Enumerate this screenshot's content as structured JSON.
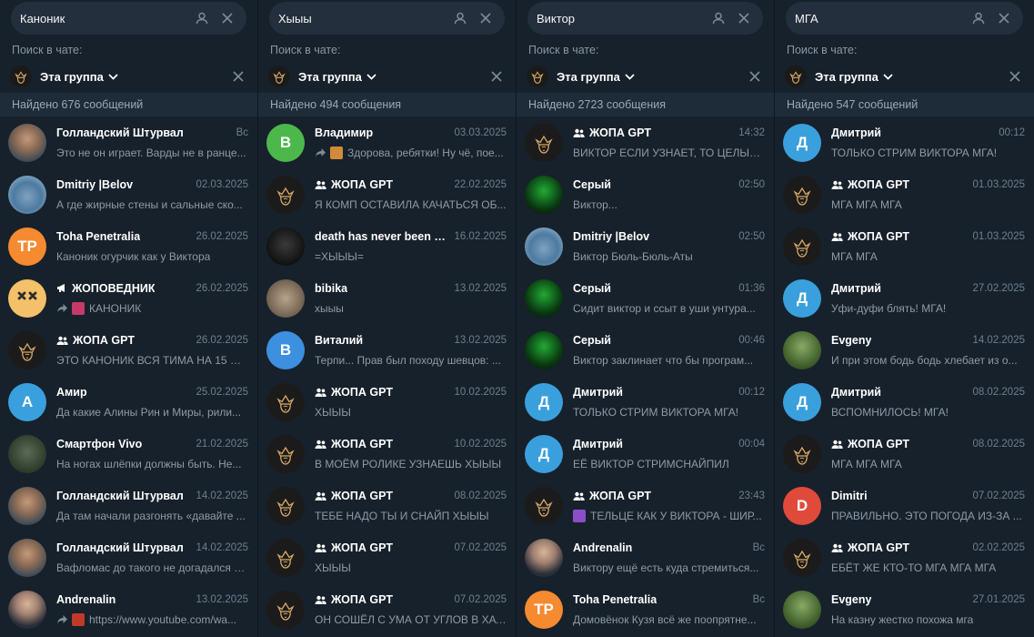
{
  "labels": {
    "search_in_chat": "Поиск в чате:"
  },
  "panels": [
    {
      "query": "Каноник",
      "group": "Эта группа",
      "found": "Найдено 676 сообщений",
      "rows": [
        {
          "name": "Голландский Штурвал",
          "date": "Вс",
          "msg": "Это не он играет. Варды не в ранце...",
          "av": "photo",
          "icon": ""
        },
        {
          "name": "Dmitriy |Belov",
          "date": "02.03.2025",
          "msg": "А где жирные стены и сальные ско...",
          "av": "photo2",
          "icon": ""
        },
        {
          "name": "Toha Penetralia",
          "date": "26.02.2025",
          "msg": "Каноник огурчик как у Виктора",
          "av": "letter",
          "letter": "TP",
          "color": "#f58a31",
          "icon": ""
        },
        {
          "name": "ЖОПОВЕДНИК",
          "date": "26.02.2025",
          "msg": "КАНОНИК",
          "av": "face",
          "icon": "megaphone",
          "fwd": true,
          "thumb": "#c63a6a"
        },
        {
          "name": "ЖОПА GPT",
          "date": "26.02.2025",
          "msg": "ЭТО КАНОНИК ВСЯ ТИМА НА 15 СО...",
          "av": "crown",
          "icon": "group"
        },
        {
          "name": "Амир",
          "date": "25.02.2025",
          "msg": "Да какие Алины Рин и Миры, рили...",
          "av": "letter",
          "letter": "А",
          "color": "#3aa0dd",
          "icon": ""
        },
        {
          "name": "Смартфон Vivo",
          "date": "21.02.2025",
          "msg": "На ногах шлёпки должны быть. Не...",
          "av": "soldier",
          "icon": ""
        },
        {
          "name": "Голландский Штурвал",
          "date": "14.02.2025",
          "msg": "Да там начали разгонять «давайте ...",
          "av": "photo",
          "icon": ""
        },
        {
          "name": "Голландский Штурвал",
          "date": "14.02.2025",
          "msg": "Вафломас до такого не догадался п...",
          "av": "photo",
          "icon": ""
        },
        {
          "name": "Andrenalin",
          "date": "13.02.2025",
          "msg": "https://www.youtube.com/wa...",
          "av": "suit",
          "icon": "",
          "fwd": true,
          "thumb": "#c0392b"
        }
      ]
    },
    {
      "query": "Хыыы",
      "group": "Эта группа",
      "found": "Найдено 494 сообщения",
      "rows": [
        {
          "name": "Владимир",
          "date": "03.03.2025",
          "msg": "Здорова, ребятки! Ну чё, пое...",
          "av": "letter",
          "letter": "В",
          "color": "#4cb84c",
          "icon": "",
          "fwd": true,
          "thumb": "#d08a3a"
        },
        {
          "name": "ЖОПА GPT",
          "date": "22.02.2025",
          "msg": "Я КОМП ОСТАВИЛА КАЧАТЬСЯ ОБ...",
          "av": "crown",
          "icon": "group"
        },
        {
          "name": "death has never been m...",
          "date": "16.02.2025",
          "msg": "=ХЫЫЫ=",
          "av": "dark",
          "icon": ""
        },
        {
          "name": "bibika",
          "date": "13.02.2025",
          "msg": "хыыы",
          "av": "cat",
          "icon": ""
        },
        {
          "name": "Виталий",
          "date": "13.02.2025",
          "msg": "Терпи... Прав был походу шевцов: ...",
          "av": "letter",
          "letter": "В",
          "color": "#3d8fe0",
          "icon": ""
        },
        {
          "name": "ЖОПА GPT",
          "date": "10.02.2025",
          "msg": "ХЫЫЫ",
          "av": "crown",
          "icon": "group"
        },
        {
          "name": "ЖОПА GPT",
          "date": "10.02.2025",
          "msg": "В МОЁМ РОЛИКЕ УЗНАЕШЬ ХЫЫЫ",
          "av": "crown",
          "icon": "group"
        },
        {
          "name": "ЖОПА GPT",
          "date": "08.02.2025",
          "msg": "ТЕБЕ НАДО ТЫ И СНАЙП ХЫЫЫ",
          "av": "crown",
          "icon": "group"
        },
        {
          "name": "ЖОПА GPT",
          "date": "07.02.2025",
          "msg": "ХЫЫЫ",
          "av": "crown",
          "icon": "group"
        },
        {
          "name": "ЖОПА GPT",
          "date": "07.02.2025",
          "msg": "ОН СОШЁЛ С УМА ОТ УГЛОВ В ХАТ...",
          "av": "crown",
          "icon": "group"
        }
      ]
    },
    {
      "query": "Виктор",
      "group": "Эта группа",
      "found": "Найдено 2723 сообщения",
      "rows": [
        {
          "name": "ЖОПА GPT",
          "date": "14:32",
          "msg": "ВИКТОР ЕСЛИ УЗНАЕТ, ТО ЦЕЛЫЙ ...",
          "av": "crown",
          "icon": "group"
        },
        {
          "name": "Серый",
          "date": "02:50",
          "msg": "Виктор...",
          "av": "green",
          "icon": ""
        },
        {
          "name": "Dmitriy |Belov",
          "date": "02:50",
          "msg": "Виктор Бюль-Бюль-Аты",
          "av": "photo2",
          "icon": ""
        },
        {
          "name": "Серый",
          "date": "01:36",
          "msg": "Сидит виктор и ссыт в уши унтура...",
          "av": "green",
          "icon": ""
        },
        {
          "name": "Серый",
          "date": "00:46",
          "msg": "Виктор заклинает что бы програм...",
          "av": "green",
          "icon": ""
        },
        {
          "name": "Дмитрий",
          "date": "00:12",
          "msg": "ТОЛЬКО СТРИМ ВИКТОРА МГА!",
          "av": "letter",
          "letter": "Д",
          "color": "#3aa0dd",
          "icon": ""
        },
        {
          "name": "Дмитрий",
          "date": "00:04",
          "msg": "ЕЁ ВИКТОР СТРИМСНАЙПИЛ",
          "av": "letter",
          "letter": "Д",
          "color": "#3aa0dd",
          "icon": ""
        },
        {
          "name": "ЖОПА GPT",
          "date": "23:43",
          "msg": "ТЕЛЬЦЕ КАК У ВИКТОРА - ШИР...",
          "av": "crown",
          "icon": "group",
          "thumb": "#8a4fc8"
        },
        {
          "name": "Andrenalin",
          "date": "Вс",
          "msg": "Виктору ещё есть куда стремиться...",
          "av": "suit",
          "icon": ""
        },
        {
          "name": "Toha Penetralia",
          "date": "Вс",
          "msg": "Домовёнок Кузя всё же поопрятне...",
          "av": "letter",
          "letter": "TP",
          "color": "#f58a31",
          "icon": ""
        }
      ]
    },
    {
      "query": "МГА",
      "group": "Эта группа",
      "found": "Найдено 547 сообщений",
      "rows": [
        {
          "name": "Дмитрий",
          "date": "00:12",
          "msg": "ТОЛЬКО СТРИМ ВИКТОРА МГА!",
          "av": "letter",
          "letter": "Д",
          "color": "#3aa0dd",
          "icon": ""
        },
        {
          "name": "ЖОПА GPT",
          "date": "01.03.2025",
          "msg": "МГА МГА МГА",
          "av": "crown",
          "icon": "group"
        },
        {
          "name": "ЖОПА GPT",
          "date": "01.03.2025",
          "msg": "МГА МГА",
          "av": "crown",
          "icon": "group"
        },
        {
          "name": "Дмитрий",
          "date": "27.02.2025",
          "msg": "Уфи-дуфи блять! МГА!",
          "av": "letter",
          "letter": "Д",
          "color": "#3aa0dd",
          "icon": ""
        },
        {
          "name": "Evgeny",
          "date": "14.02.2025",
          "msg": "И при этом бодь бодь хлебает из о...",
          "av": "troll",
          "icon": ""
        },
        {
          "name": "Дмитрий",
          "date": "08.02.2025",
          "msg": "ВСПОМНИЛОСЬ! МГА!",
          "av": "letter",
          "letter": "Д",
          "color": "#3aa0dd",
          "icon": ""
        },
        {
          "name": "ЖОПА GPT",
          "date": "08.02.2025",
          "msg": "МГА МГА МГА",
          "av": "crown",
          "icon": "group"
        },
        {
          "name": "Dimitri",
          "date": "07.02.2025",
          "msg": "ПРАВИЛЬНО. ЭТО ПОГОДА ИЗ-ЗА ...",
          "av": "letter",
          "letter": "D",
          "color": "#e04a3a",
          "icon": ""
        },
        {
          "name": "ЖОПА GPT",
          "date": "02.02.2025",
          "msg": "ЕБЁТ ЖЕ КТО-ТО МГА МГА МГА",
          "av": "crown",
          "icon": "group"
        },
        {
          "name": "Evgeny",
          "date": "27.01.2025",
          "msg": "На казну жестко похожа мга",
          "av": "troll",
          "icon": ""
        }
      ]
    }
  ]
}
